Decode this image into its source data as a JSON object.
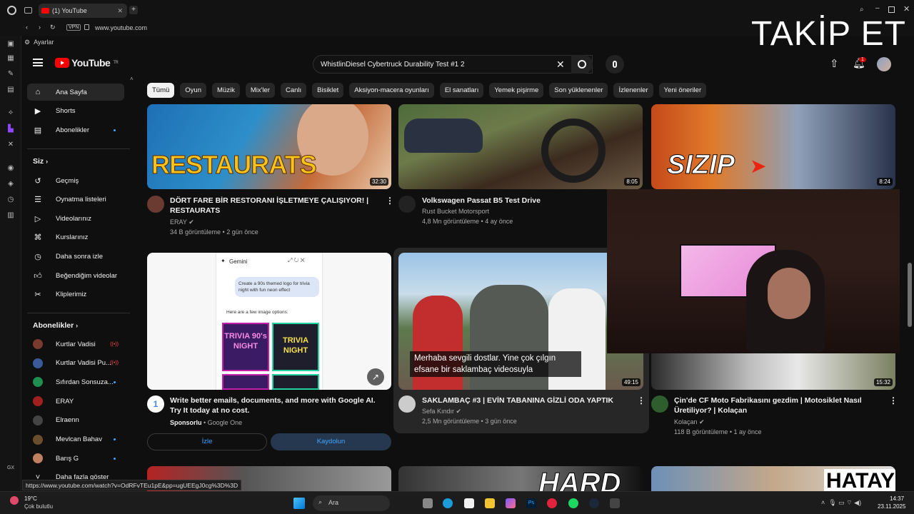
{
  "browser": {
    "tab_title": "(1) YouTube",
    "url": "www.youtube.com",
    "vpn_label": "VPN",
    "settings_label": "Ayarlar"
  },
  "overlay": {
    "text": "TAKİP ET"
  },
  "header": {
    "logo_text": "YouTube",
    "region": "TR",
    "search_value": "WhistlinDiesel Cybertruck Durability Test #1 2",
    "notif_count": "1"
  },
  "chips": [
    "Tümü",
    "Oyun",
    "Müzik",
    "Mix'ler",
    "Canlı",
    "Bisiklet",
    "Aksiyon-macera oyunları",
    "El sanatları",
    "Yemek pişirme",
    "Son yüklenenler",
    "İzlenenler",
    "Yeni öneriler"
  ],
  "guide": {
    "main": [
      {
        "label": "Ana Sayfa",
        "icon": "home-icon"
      },
      {
        "label": "Shorts",
        "icon": "shorts-icon"
      },
      {
        "label": "Abonelikler",
        "icon": "subscriptions-icon"
      }
    ],
    "you_title": "Siz",
    "you": [
      {
        "label": "Geçmiş",
        "icon": "history-icon"
      },
      {
        "label": "Oynatma listeleri",
        "icon": "playlist-icon"
      },
      {
        "label": "Videolarınız",
        "icon": "video-icon"
      },
      {
        "label": "Kurslarınız",
        "icon": "course-icon"
      },
      {
        "label": "Daha sonra izle",
        "icon": "clock-icon"
      },
      {
        "label": "Beğendiğim videolar",
        "icon": "like-icon"
      },
      {
        "label": "Kliplerimiz",
        "icon": "scissors-icon"
      }
    ],
    "subs_title": "Abonelikler",
    "subs": [
      {
        "label": "Kurtlar Vadisi",
        "color": "#7a3b2e",
        "status": "live"
      },
      {
        "label": "Kurtlar Vadisi Pu...",
        "color": "#3a5a9a",
        "status": "live"
      },
      {
        "label": "Sıfırdan Sonsuza...",
        "color": "#1e8f4e",
        "status": "dot"
      },
      {
        "label": "ERAY",
        "color": "#a02020",
        "status": ""
      },
      {
        "label": "Elraenn",
        "color": "#444444",
        "status": ""
      },
      {
        "label": "Mevlcan Bahav",
        "color": "#6b4e2e",
        "status": "dot"
      },
      {
        "label": "Barış G",
        "color": "#c08060",
        "status": "dot"
      },
      {
        "label": "Daha fazla göster",
        "color": "",
        "status": ""
      }
    ]
  },
  "videos": [
    {
      "title": "DÖRT FARE BİR RESTORANI İŞLETMEYE ÇALIŞIYOR! | RESTAURATS",
      "channel": "ERAY",
      "meta": "34 B görüntüleme • 2 gün önce",
      "duration": "32:30",
      "thumb_text": "RESTAURATS"
    },
    {
      "title": "Volkswagen Passat B5 Test Drive",
      "channel": "Rust Bucket Motorsport",
      "meta": "4,8 Mn görüntüleme • 4 ay önce",
      "duration": "8:05"
    },
    {
      "duration": "8:24",
      "thumb_text": "SIZIP"
    },
    {
      "title": "Write better emails, documents, and more with Google AI. Try It today at no cost.",
      "sponsor": "Sponsorlu",
      "channel": "Google One",
      "btn_watch": "İzle",
      "btn_signup": "Kaydolun",
      "ad_panel_title": "Gemini",
      "ad_prompt": "Create a 90s themed logo for trivia night with fun neon effect",
      "ad_reply": "Here are a few image options:",
      "ad_tile1": "TRIVIA 90's NIGHT",
      "ad_tile2": "TRIVIA NIGHT"
    },
    {
      "title": "SAKLAMBAÇ #3 | EVİN TABANINA GİZLİ ODA YAPTIK",
      "channel": "Sefa Kındır",
      "meta": "2,5 Mn görüntüleme • 3 gün önce",
      "duration": "49:15",
      "caption": "Merhaba sevgili dostlar. Yine çok çılgın efsane bir saklambaç videosuyla"
    },
    {
      "title": "Çin'de CF Moto Fabrikasını gezdim | Motosiklet Nasıl Üretiliyor? | Kolaçan",
      "channel": "Kolaçan",
      "meta": "118 B görüntüleme • 1 ay önce",
      "duration": "15:32"
    }
  ],
  "bottom_thumbs": [
    "HARD",
    "HATAY"
  ],
  "status_url": "https://www.youtube.com/watch?v=OdRFvTEu1pE&pp=ugUEEgJ0cg%3D%3D",
  "taskbar": {
    "temp": "19°C",
    "weather": "Çok bulutlu",
    "search_placeholder": "Ara",
    "time": "14:37",
    "date": "23.11.2025"
  },
  "colors": {
    "accent": "#ff0000",
    "bg": "#0f0f0f",
    "chip": "#272727",
    "link": "#3ea6ff"
  }
}
